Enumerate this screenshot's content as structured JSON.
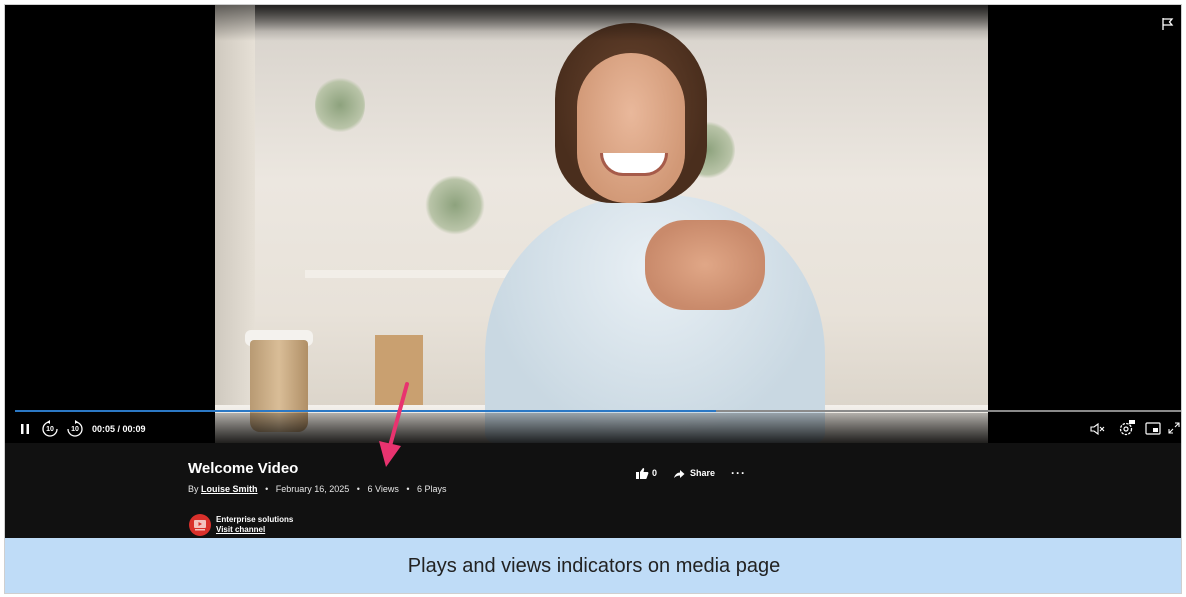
{
  "player": {
    "progress_fraction": 0.6,
    "time_display": "00:05 / 00:09",
    "skip_back_label": "10",
    "skip_forward_label": "10"
  },
  "media": {
    "title": "Welcome Video",
    "by_prefix": "By",
    "author": "Louise Smith",
    "date": "February 16, 2025",
    "views": "6 Views",
    "plays": "6 Plays",
    "likes": "0",
    "share_label": "Share",
    "more_label": "···"
  },
  "channel": {
    "name": "Enterprise solutions",
    "link_label": "Visit channel"
  },
  "caption": "Plays and views indicators on media page",
  "colors": {
    "progress": "#2b78c5",
    "caption_bg": "#bfdcf7",
    "arrow": "#e8336f",
    "channel_logo": "#d9302b"
  }
}
